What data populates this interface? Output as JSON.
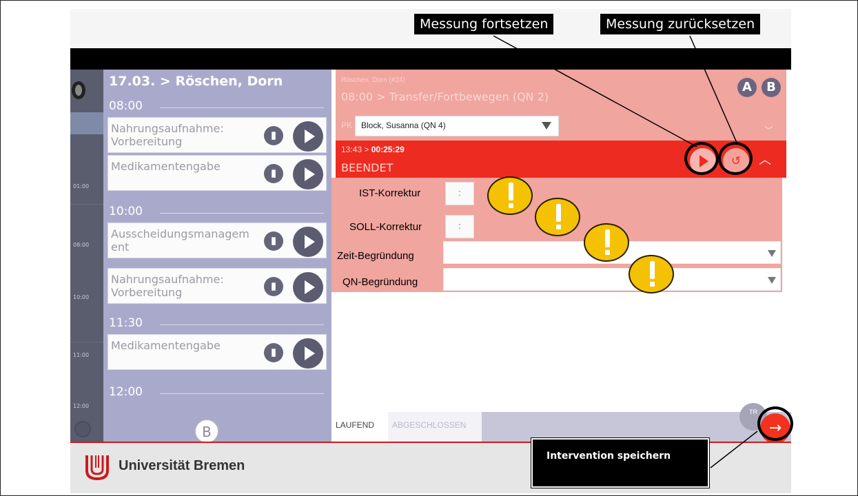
{
  "callouts": {
    "continue": "Messung fortsetzen",
    "reset": "Messung zurücksetzen",
    "save": "Intervention speichern"
  },
  "left": {
    "title": "17.03. > Röschen, Dorn",
    "times": [
      "08:00",
      "10:00",
      "11:30",
      "12:00"
    ],
    "tasks": [
      {
        "label": "Nahrungsaufnahme: Vorbereitung"
      },
      {
        "label": "Medikamentengabe"
      },
      {
        "label": "Ausscheidungsmanagem ent"
      },
      {
        "label": "Nahrungsaufnahme: Vorbereitung"
      },
      {
        "label": "Medikamentengabe"
      }
    ],
    "footer_button": "B"
  },
  "rail": {
    "times": [
      "01:00",
      "08:00",
      "10:00",
      "11:00",
      "12:00"
    ]
  },
  "detail": {
    "client": "Röschen, Dorn (#24)",
    "slot": "08:00 > Transfer/Fortbewegen (QN 2)",
    "btn_a": "A",
    "btn_b": "B",
    "pk_label": "PK",
    "pk_value": "Block, Susanna (QN 4)",
    "timer_prefix": "13:43 >",
    "timer_value": "00:25:29",
    "status": "BEENDET",
    "reset_glyph": "↺",
    "ist_label": "IST-Korrektur",
    "soll_label": "SOLL-Korrektur",
    "zeit_label": "Zeit-Begründung",
    "qn_label": "QN-Begründung",
    "time_placeholder": ":"
  },
  "tabs": {
    "running": "LAUFEND",
    "done": "ABGESCHLOSSEN"
  },
  "transfer_label": "TR",
  "save_glyph": "→",
  "footer": {
    "logo_text": "Universität Bremen"
  },
  "colors": {
    "accent_red": "#ee2b20",
    "header_salmon": "#f0a59e",
    "panel_lavender": "#a9aacb",
    "warning_yellow": "#f4c103"
  }
}
